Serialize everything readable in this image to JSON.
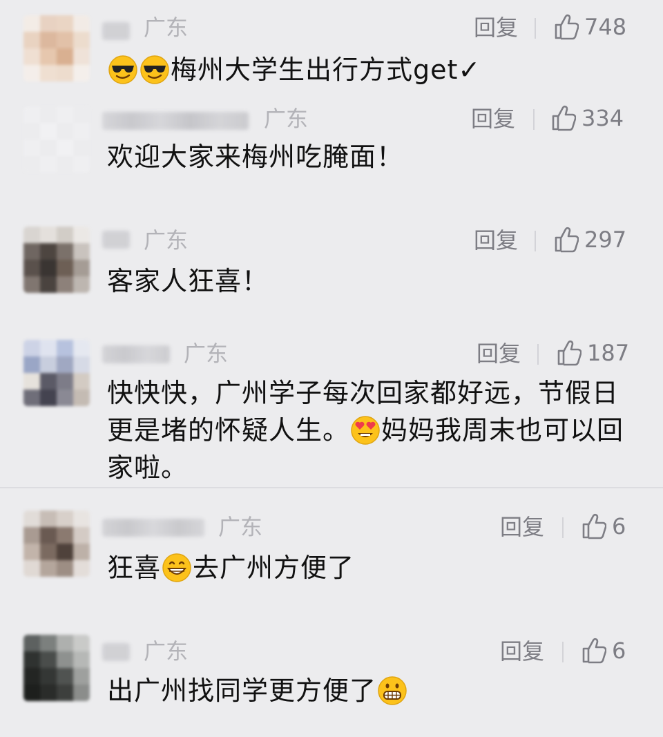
{
  "comments": [
    {
      "location": "广东",
      "reply_label": "回复",
      "likes": "748",
      "text_parts": [
        "",
        "梅州大学生出行方式get✓"
      ],
      "emojis": [
        "sunglasses-emoji",
        "sunglasses-emoji"
      ]
    },
    {
      "location": "广东",
      "reply_label": "回复",
      "likes": "334",
      "text": "欢迎大家来梅州吃腌面！"
    },
    {
      "location": "广东",
      "reply_label": "回复",
      "likes": "297",
      "text": "客家人狂喜！"
    },
    {
      "location": "广东",
      "reply_label": "回复",
      "likes": "187",
      "text_part1": "快快快，广州学子每次回家都好远，节假日更是堵的怀疑人生。",
      "text_part2": "妈妈我周末也可以回家啦。",
      "emojis": [
        "heart-eyes-emoji"
      ]
    },
    {
      "location": "广东",
      "reply_label": "回复",
      "likes": "6",
      "text_part1": "狂喜",
      "text_part2": "去广州方便了",
      "emojis": [
        "grinning-emoji"
      ]
    },
    {
      "location": "广东",
      "reply_label": "回复",
      "likes": "6",
      "text_part1": "出广州找同学更方便了",
      "emojis": [
        "grimacing-emoji"
      ]
    }
  ],
  "colors": {
    "background": "#ececee",
    "meta_text": "#7d7d84",
    "location_text": "#b3b3b8",
    "body_text": "#111111"
  }
}
